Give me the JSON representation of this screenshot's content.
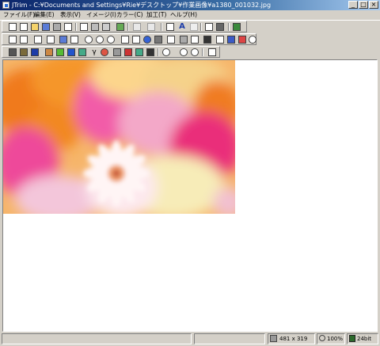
{
  "window": {
    "title": "JTrim - C:¥Documents and Settings¥Rie¥デスクトップ¥作業画像¥a1380_001032.jpg",
    "minimize": "_",
    "maximize": "□",
    "close": "×"
  },
  "menu": [
    "ファイル(F)",
    "編集(E)",
    "表示(V)",
    "イメージ(I)",
    "カラー(C)",
    "加工(T)",
    "ヘルプ(H)"
  ],
  "status": {
    "dimensions": "481 x 319",
    "zoom": "100%",
    "depth": "24bit"
  },
  "colors": {
    "window_bg": "#d4d0c8",
    "title_start": "#0a246a",
    "title_end": "#a6caf0"
  }
}
